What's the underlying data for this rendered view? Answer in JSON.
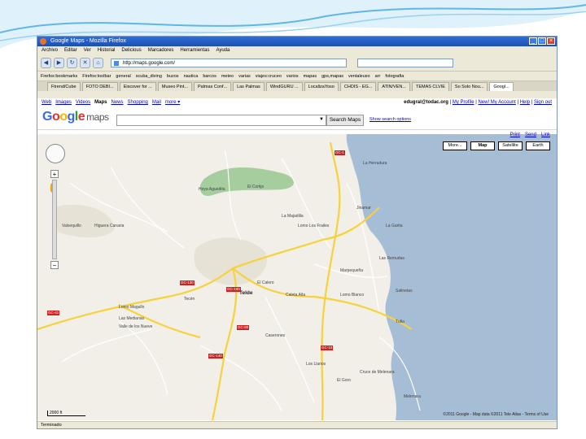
{
  "window": {
    "title": "Google Maps - Mozilla Firefox",
    "menu": [
      "Archivo",
      "Editar",
      "Ver",
      "Historial",
      "Delicious",
      "Marcadores",
      "Herramientas",
      "Ayuda"
    ],
    "url": "http://maps.google.com/"
  },
  "bookmarks": [
    "Firefox:bookmarks",
    "Firefox:toolbar",
    "general",
    "scuba_diving",
    "buzos",
    "nautica",
    "barcos",
    "meteo",
    "varias",
    "viajes:cruceo",
    "varios",
    "mapas",
    "gps,mapas",
    "ventaleuxo",
    "arr",
    "fotografia"
  ],
  "tabs": [
    "Ftrend/Cube",
    "FOTO DEBI...",
    "Eiscover for ...",
    "Museo Pint...",
    "Palmas Conf...",
    "Las Palmas",
    "WindGURU ...",
    "LocalizaYoso",
    "CHDIS - EG...",
    "ATIN/VEN...",
    "TEMAS CLVIE",
    "So Solo Nou...",
    "Googl..."
  ],
  "google": {
    "nav": [
      "Web",
      "Images",
      "Videos",
      "Maps",
      "News",
      "Shopping",
      "Mail",
      "more ▾"
    ],
    "active_nav": "Maps",
    "user": "edugral@todac.org",
    "user_links": [
      "My Profile",
      "New! My Account",
      "Help",
      "Sign out"
    ],
    "logo": "Google",
    "logo_suffix": "maps",
    "search_button": "Search Maps",
    "search_options": "Show search options",
    "print_links": [
      "Print",
      "Send",
      "Link"
    ],
    "map_types": [
      "More...",
      "Map",
      "Satellite",
      "Earth"
    ],
    "selected_map_type": "Map"
  },
  "map": {
    "scale": "2000 ft",
    "copyright": "©2011 Google - Map data ©2011 Tele Atlas - Terms of Use",
    "labels": [
      {
        "text": "Telde",
        "big": true
      },
      {
        "text": "La Majadilla"
      },
      {
        "text": "Lomo Blanco"
      },
      {
        "text": "Jinamar"
      },
      {
        "text": "Marpequeña"
      },
      {
        "text": "Caleta Alta"
      },
      {
        "text": "El Goro"
      },
      {
        "text": "Cruce de Melenara"
      },
      {
        "text": "Melenara"
      },
      {
        "text": "Tufia"
      },
      {
        "text": "Salinetas"
      },
      {
        "text": "Las Remudas"
      },
      {
        "text": "Lomo Magullo"
      },
      {
        "text": "La Herradura"
      },
      {
        "text": "Los Llanos"
      },
      {
        "text": "Valle de los Nueve"
      },
      {
        "text": "Las Medianas"
      },
      {
        "text": "Caserones"
      },
      {
        "text": "El Cortijo"
      },
      {
        "text": "Lomo Los Frailes"
      },
      {
        "text": "Tecén"
      },
      {
        "text": "Valsequillo"
      },
      {
        "text": "El Calero"
      },
      {
        "text": "La Garita"
      },
      {
        "text": "Hoya Aguedita"
      },
      {
        "text": "Higuera Canaria"
      }
    ],
    "road_badges": [
      "GC-1",
      "GC-100",
      "GC-41",
      "GC-140",
      "GC-10",
      "GC-80",
      "GC-130"
    ]
  },
  "status": "Terminado",
  "colors": {
    "water": "#a6bdd6",
    "land": "#f1efe8",
    "park": "#a5cd9e",
    "road_major": "#f6d23b",
    "road_minor": "#ffffff"
  }
}
